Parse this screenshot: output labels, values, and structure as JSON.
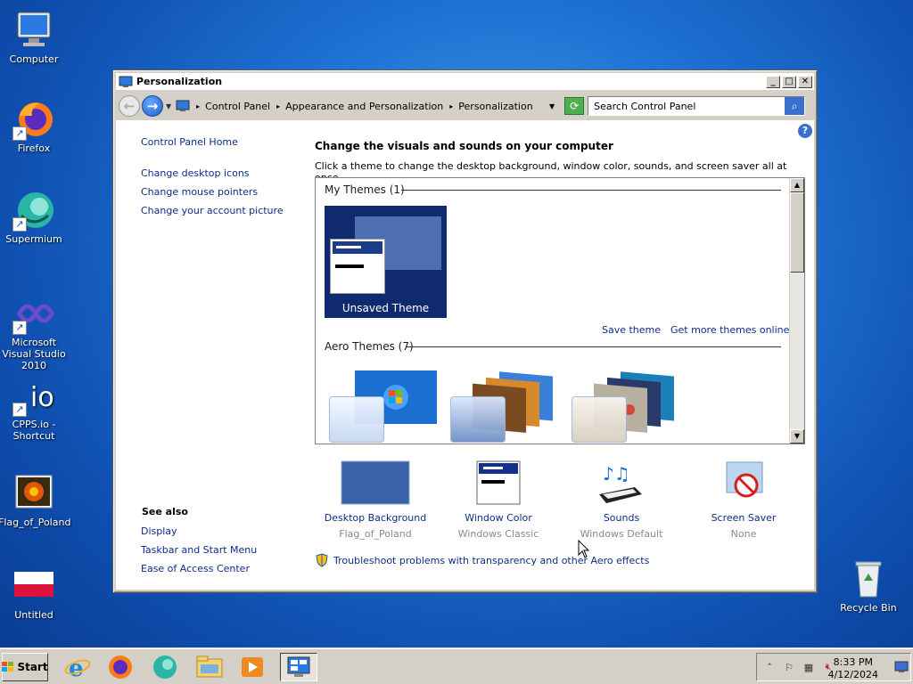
{
  "desktop": {
    "icons": [
      {
        "label": "Computer",
        "icon": "computer-icon"
      },
      {
        "label": "Firefox",
        "icon": "firefox-icon"
      },
      {
        "label": "Supermium",
        "icon": "supermium-icon"
      },
      {
        "label": "Microsoft Visual Studio 2010",
        "icon": "visual-studio-icon"
      },
      {
        "label": "CPPS.io - Shortcut",
        "icon": "cpps-icon"
      },
      {
        "label": "Flag_of_Poland",
        "icon": "image-file-icon"
      },
      {
        "label": "Untitled",
        "icon": "poland-flag-icon"
      },
      {
        "label": "Recycle Bin",
        "icon": "recycle-bin-icon"
      }
    ]
  },
  "window": {
    "title": "Personalization",
    "controls": {
      "minimize": "_",
      "maximize": "□",
      "close": "✕"
    },
    "breadcrumb": [
      "Control Panel",
      "Appearance and Personalization",
      "Personalization"
    ],
    "search_placeholder": "Search Control Panel",
    "left_pane": {
      "home": "Control Panel Home",
      "links": [
        "Change desktop icons",
        "Change mouse pointers",
        "Change your account picture"
      ],
      "see_also_title": "See also",
      "see_also": [
        "Display",
        "Taskbar and Start Menu",
        "Ease of Access Center"
      ]
    },
    "heading": "Change the visuals and sounds on your computer",
    "subtext": "Click a theme to change the desktop background, window color, sounds, and screen saver all at once.",
    "themes": {
      "my_themes_header": "My Themes (1)",
      "unsaved_label": "Unsaved Theme",
      "save_theme": "Save theme",
      "get_more": "Get more themes online",
      "aero_header": "Aero Themes (7)"
    },
    "settings": [
      {
        "label": "Desktop Background",
        "value": "Flag_of_Poland"
      },
      {
        "label": "Window Color",
        "value": "Windows Classic"
      },
      {
        "label": "Sounds",
        "value": "Windows Default"
      },
      {
        "label": "Screen Saver",
        "value": "None"
      }
    ],
    "troubleshoot": "Troubleshoot problems with transparency and other Aero effects"
  },
  "taskbar": {
    "start_label": "Start",
    "clock_time": "8:33 PM",
    "clock_date": "4/12/2024"
  },
  "colors": {
    "link": "#0c2d8a",
    "desktop_bg": "#1f74d4",
    "theme_bg": "#0f2a6e"
  }
}
